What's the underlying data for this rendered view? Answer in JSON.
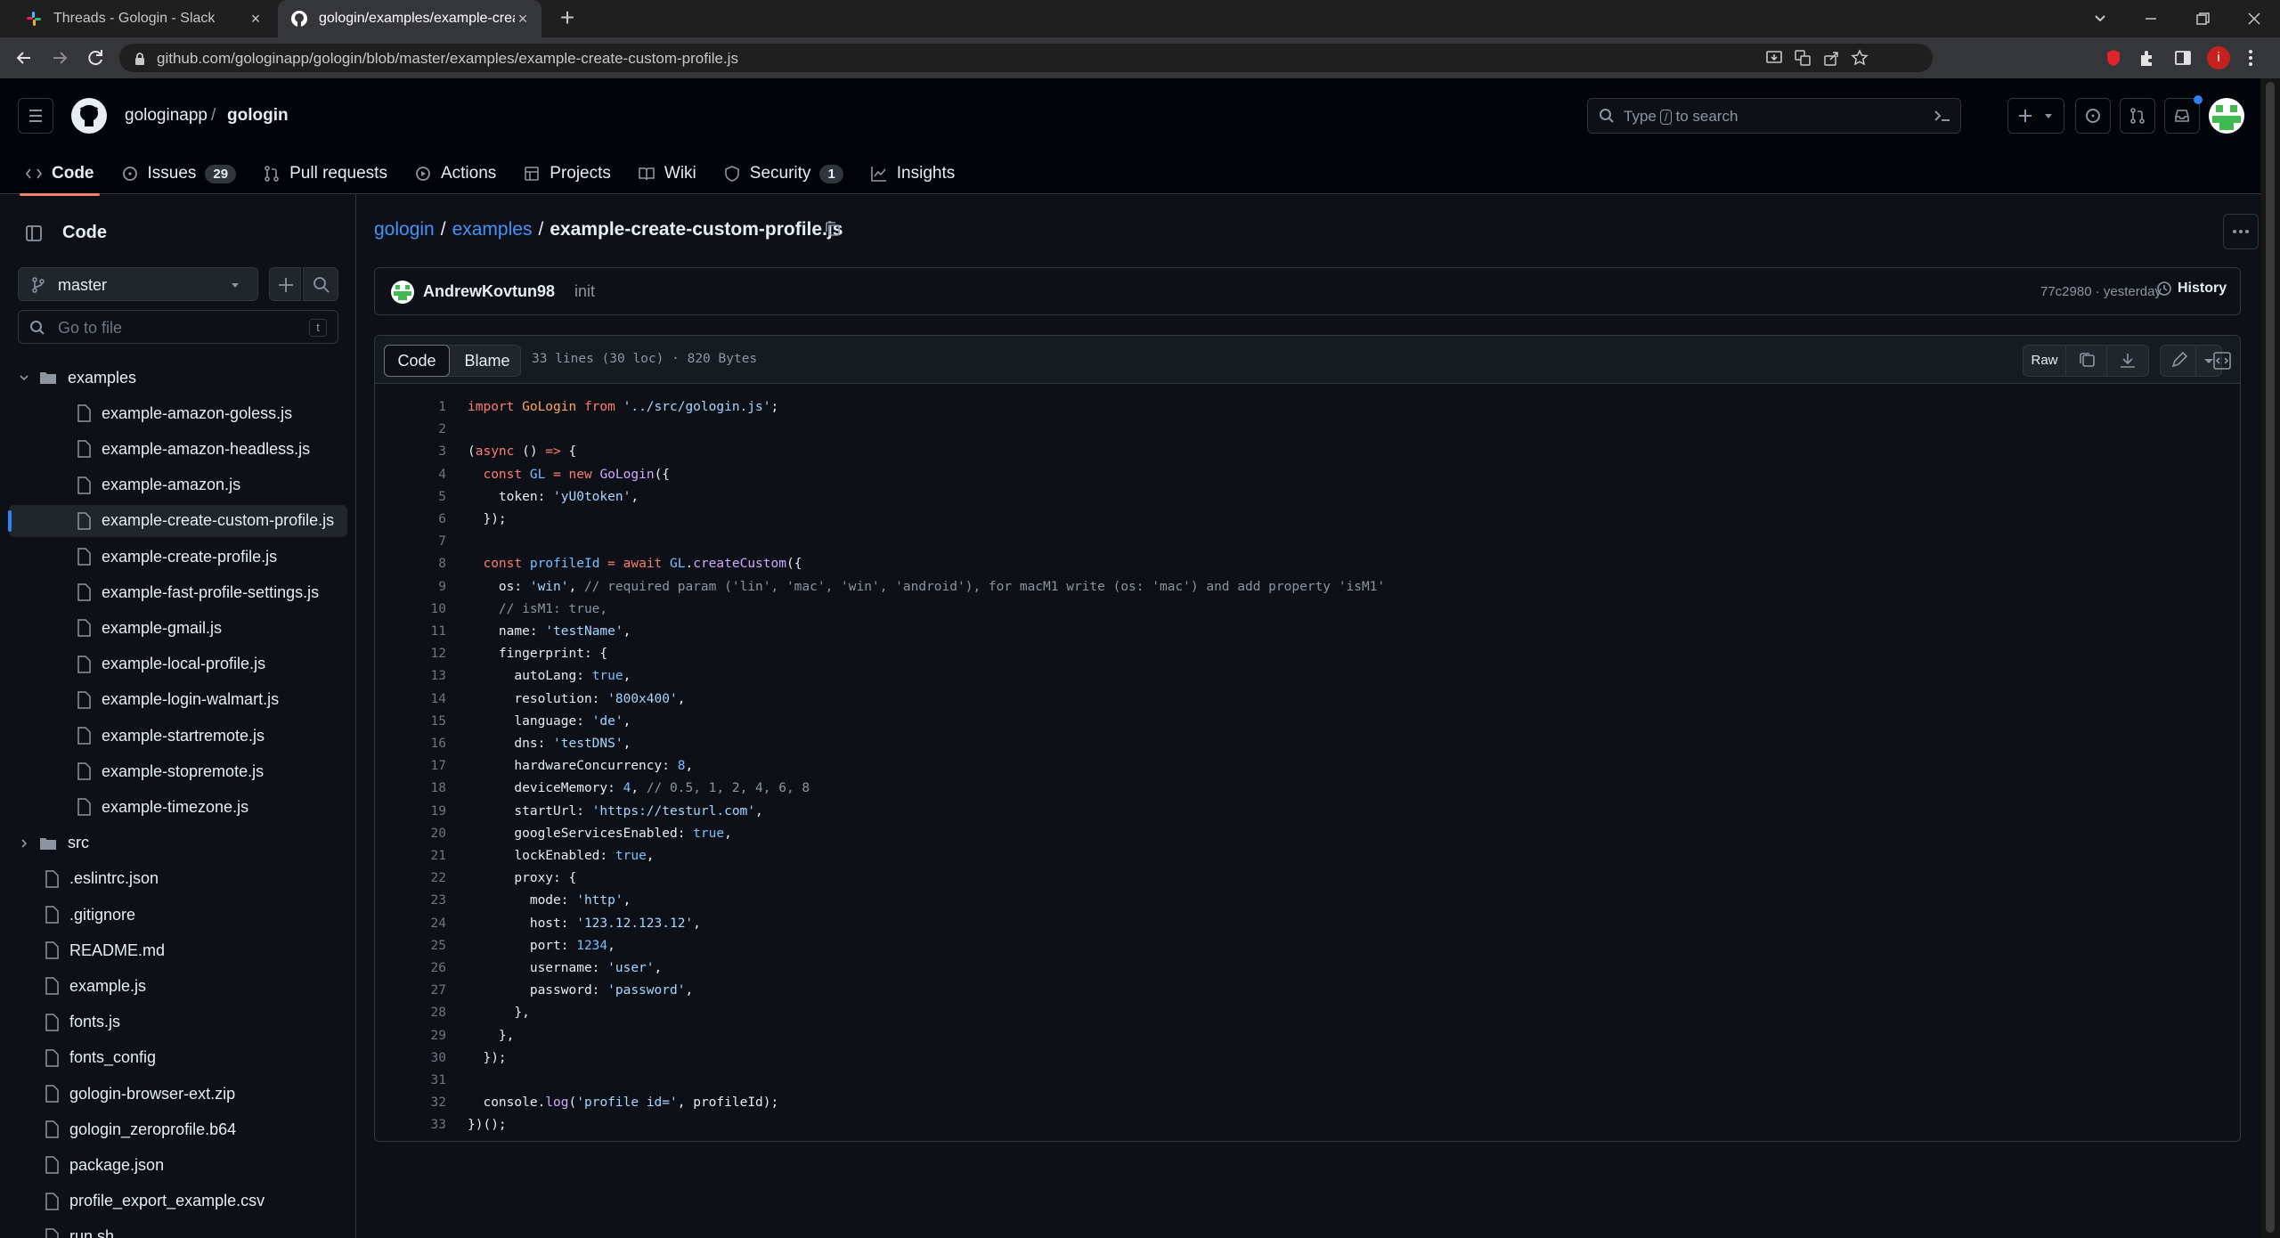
{
  "browser": {
    "tabs": [
      {
        "title": "Threads - Gologin - Slack",
        "active": false
      },
      {
        "title": "gologin/examples/example-creat",
        "active": true
      }
    ],
    "url": "github.com/gologinapp/gologin/blob/master/examples/example-create-custom-profile.js",
    "profile_initial": "i"
  },
  "github": {
    "owner": "gologinapp",
    "separator": "/",
    "repo": "gologin",
    "search_placeholder_pre": "Type",
    "search_key": "/",
    "search_placeholder_post": "to search",
    "tabs": [
      {
        "label": "Code",
        "icon": "code-icon",
        "active": true
      },
      {
        "label": "Issues",
        "icon": "issue-icon",
        "count": "29"
      },
      {
        "label": "Pull requests",
        "icon": "pull-request-icon"
      },
      {
        "label": "Actions",
        "icon": "play-icon"
      },
      {
        "label": "Projects",
        "icon": "table-icon"
      },
      {
        "label": "Wiki",
        "icon": "book-icon"
      },
      {
        "label": "Security",
        "icon": "shield-icon",
        "count": "1"
      },
      {
        "label": "Insights",
        "icon": "graph-icon"
      }
    ]
  },
  "sidebar": {
    "title": "Code",
    "branch": "master",
    "goto_placeholder": "Go to file",
    "goto_key": "t",
    "tree": [
      {
        "name": "examples",
        "type": "folder",
        "open": true,
        "depth": 0
      },
      {
        "name": "example-amazon-goless.js",
        "type": "file",
        "depth": 1
      },
      {
        "name": "example-amazon-headless.js",
        "type": "file",
        "depth": 1
      },
      {
        "name": "example-amazon.js",
        "type": "file",
        "depth": 1
      },
      {
        "name": "example-create-custom-profile.js",
        "type": "file",
        "depth": 1,
        "active": true
      },
      {
        "name": "example-create-profile.js",
        "type": "file",
        "depth": 1
      },
      {
        "name": "example-fast-profile-settings.js",
        "type": "file",
        "depth": 1
      },
      {
        "name": "example-gmail.js",
        "type": "file",
        "depth": 1
      },
      {
        "name": "example-local-profile.js",
        "type": "file",
        "depth": 1
      },
      {
        "name": "example-login-walmart.js",
        "type": "file",
        "depth": 1
      },
      {
        "name": "example-startremote.js",
        "type": "file",
        "depth": 1
      },
      {
        "name": "example-stopremote.js",
        "type": "file",
        "depth": 1
      },
      {
        "name": "example-timezone.js",
        "type": "file",
        "depth": 1
      },
      {
        "name": "src",
        "type": "folder",
        "open": false,
        "depth": 0
      },
      {
        "name": ".eslintrc.json",
        "type": "file",
        "depth": 0
      },
      {
        "name": ".gitignore",
        "type": "file",
        "depth": 0
      },
      {
        "name": "README.md",
        "type": "file",
        "depth": 0
      },
      {
        "name": "example.js",
        "type": "file",
        "depth": 0
      },
      {
        "name": "fonts.js",
        "type": "file",
        "depth": 0
      },
      {
        "name": "fonts_config",
        "type": "file",
        "depth": 0
      },
      {
        "name": "gologin-browser-ext.zip",
        "type": "file",
        "depth": 0
      },
      {
        "name": "gologin_zeroprofile.b64",
        "type": "file",
        "depth": 0
      },
      {
        "name": "package.json",
        "type": "file",
        "depth": 0
      },
      {
        "name": "profile_export_example.csv",
        "type": "file",
        "depth": 0
      },
      {
        "name": "run.sh",
        "type": "file",
        "depth": 0
      }
    ]
  },
  "file": {
    "breadcrumb": [
      {
        "label": "gologin",
        "link": true
      },
      {
        "label": "/",
        "link": false
      },
      {
        "label": "examples",
        "link": true
      },
      {
        "label": "/",
        "link": false
      },
      {
        "label": "example-create-custom-profile.js",
        "link": false
      }
    ],
    "commit_author": "AndrewKovtun98",
    "commit_message": "init",
    "commit_meta": "77c2980 · yesterday",
    "history_label": "History",
    "view_tabs": {
      "code": "Code",
      "blame": "Blame"
    },
    "stats": "33 lines (30 loc) · 820 Bytes",
    "raw_label": "Raw"
  },
  "code": [
    [
      [
        "kw",
        "import "
      ],
      [
        "var",
        "GoLogin "
      ],
      [
        "kw",
        "from "
      ],
      [
        "str",
        "'../src/gologin.js'"
      ],
      [
        "plain",
        ";"
      ]
    ],
    [],
    [
      [
        "plain",
        "("
      ],
      [
        "kw",
        "async "
      ],
      [
        "plain",
        "() "
      ],
      [
        "kw",
        "=> "
      ],
      [
        "plain",
        "{"
      ]
    ],
    [
      [
        "plain",
        "  "
      ],
      [
        "kw",
        "const "
      ],
      [
        "num",
        "GL "
      ],
      [
        "kw",
        "= new "
      ],
      [
        "fn",
        "GoLogin"
      ],
      [
        "plain",
        "({"
      ]
    ],
    [
      [
        "plain",
        "    token: "
      ],
      [
        "str",
        "'yU0token'"
      ],
      [
        "plain",
        ","
      ]
    ],
    [
      [
        "plain",
        "  });"
      ]
    ],
    [],
    [
      [
        "plain",
        "  "
      ],
      [
        "kw",
        "const "
      ],
      [
        "num",
        "profileId "
      ],
      [
        "kw",
        "= await "
      ],
      [
        "num",
        "GL"
      ],
      [
        "plain",
        "."
      ],
      [
        "fn",
        "createCustom"
      ],
      [
        "plain",
        "({"
      ]
    ],
    [
      [
        "plain",
        "    os: "
      ],
      [
        "str",
        "'win'"
      ],
      [
        "plain",
        ", "
      ],
      [
        "cm",
        "// required param ('lin', 'mac', 'win', 'android'), for macM1 write (os: 'mac') and add property 'isM1'"
      ]
    ],
    [
      [
        "plain",
        "    "
      ],
      [
        "cm",
        "// isM1: true,"
      ]
    ],
    [
      [
        "plain",
        "    name: "
      ],
      [
        "str",
        "'testName'"
      ],
      [
        "plain",
        ","
      ]
    ],
    [
      [
        "plain",
        "    fingerprint: {"
      ]
    ],
    [
      [
        "plain",
        "      autoLang: "
      ],
      [
        "num",
        "true"
      ],
      [
        "plain",
        ","
      ]
    ],
    [
      [
        "plain",
        "      resolution: "
      ],
      [
        "str",
        "'800x400'"
      ],
      [
        "plain",
        ","
      ]
    ],
    [
      [
        "plain",
        "      language: "
      ],
      [
        "str",
        "'de'"
      ],
      [
        "plain",
        ","
      ]
    ],
    [
      [
        "plain",
        "      dns: "
      ],
      [
        "str",
        "'testDNS'"
      ],
      [
        "plain",
        ","
      ]
    ],
    [
      [
        "plain",
        "      hardwareConcurrency: "
      ],
      [
        "num",
        "8"
      ],
      [
        "plain",
        ","
      ]
    ],
    [
      [
        "plain",
        "      deviceMemory: "
      ],
      [
        "num",
        "4"
      ],
      [
        "plain",
        ", "
      ],
      [
        "cm",
        "// 0.5, 1, 2, 4, 6, 8"
      ]
    ],
    [
      [
        "plain",
        "      startUrl: "
      ],
      [
        "str",
        "'https://testurl.com'"
      ],
      [
        "plain",
        ","
      ]
    ],
    [
      [
        "plain",
        "      googleServicesEnabled: "
      ],
      [
        "num",
        "true"
      ],
      [
        "plain",
        ","
      ]
    ],
    [
      [
        "plain",
        "      lockEnabled: "
      ],
      [
        "num",
        "true"
      ],
      [
        "plain",
        ","
      ]
    ],
    [
      [
        "plain",
        "      proxy: {"
      ]
    ],
    [
      [
        "plain",
        "        mode: "
      ],
      [
        "str",
        "'http'"
      ],
      [
        "plain",
        ","
      ]
    ],
    [
      [
        "plain",
        "        host: "
      ],
      [
        "str",
        "'123.12.123.12'"
      ],
      [
        "plain",
        ","
      ]
    ],
    [
      [
        "plain",
        "        port: "
      ],
      [
        "num",
        "1234"
      ],
      [
        "plain",
        ","
      ]
    ],
    [
      [
        "plain",
        "        username: "
      ],
      [
        "str",
        "'user'"
      ],
      [
        "plain",
        ","
      ]
    ],
    [
      [
        "plain",
        "        password: "
      ],
      [
        "str",
        "'password'"
      ],
      [
        "plain",
        ","
      ]
    ],
    [
      [
        "plain",
        "      },"
      ]
    ],
    [
      [
        "plain",
        "    },"
      ]
    ],
    [
      [
        "plain",
        "  });"
      ]
    ],
    [],
    [
      [
        "plain",
        "  console."
      ],
      [
        "fn",
        "log"
      ],
      [
        "plain",
        "("
      ],
      [
        "str",
        "'profile id='"
      ],
      [
        "plain",
        ", profileId);"
      ]
    ],
    [
      [
        "plain",
        "})();"
      ]
    ]
  ]
}
